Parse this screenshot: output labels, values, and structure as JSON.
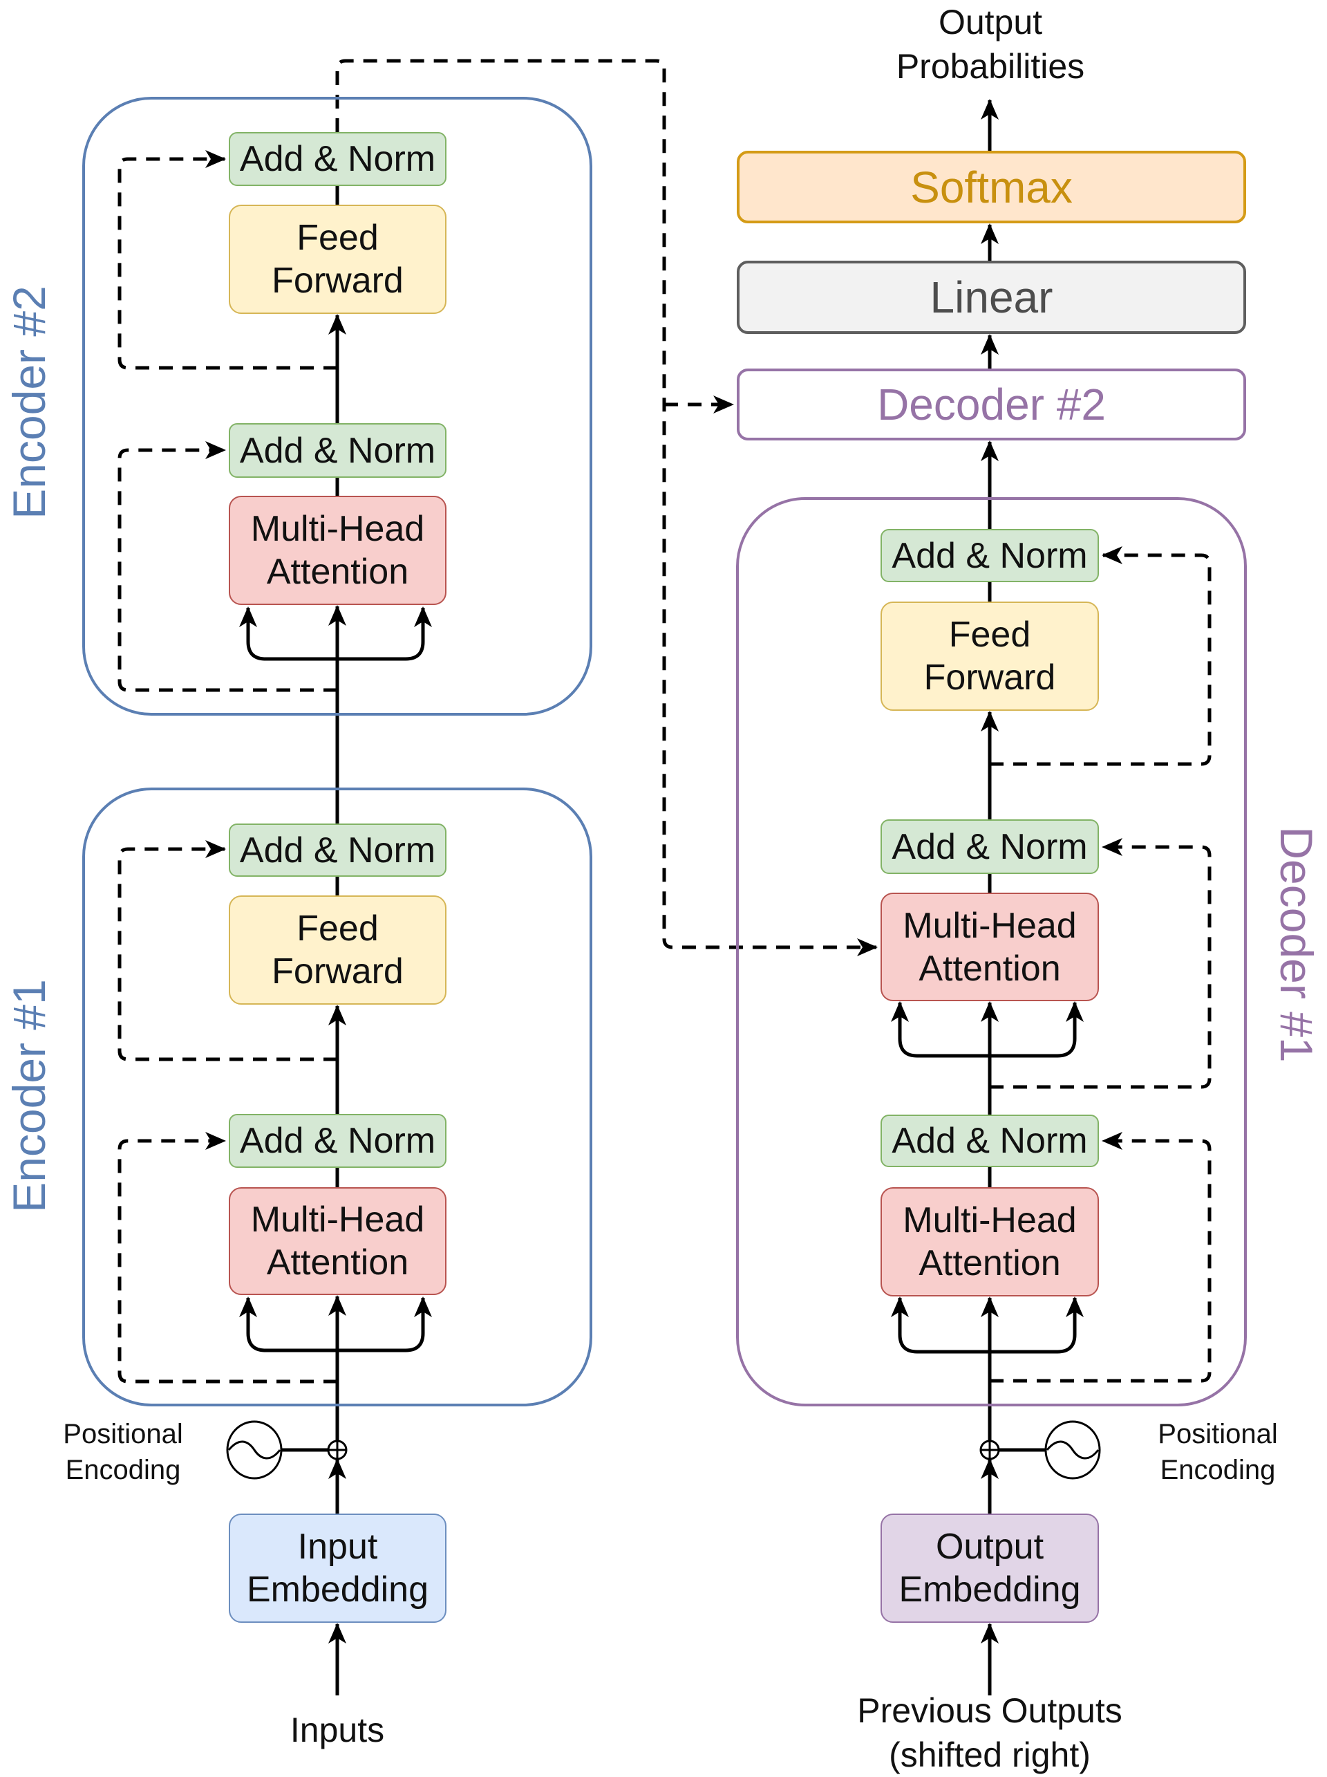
{
  "encoders": [
    {
      "label": "Encoder #2",
      "add_norm_top": "Add & Norm",
      "feed_forward": "Feed\nForward",
      "add_norm_bottom": "Add & Norm",
      "attention": "Multi-Head\nAttention"
    },
    {
      "label": "Encoder #1",
      "add_norm_top": "Add & Norm",
      "feed_forward": "Feed\nForward",
      "add_norm_bottom": "Add & Norm",
      "attention": "Multi-Head\nAttention"
    }
  ],
  "decoder1": {
    "label": "Decoder #1",
    "add_norm_top": "Add & Norm",
    "feed_forward": "Feed\nForward",
    "add_norm_middle": "Add & Norm",
    "cross_attention": "Multi-Head\nAttention",
    "add_norm_bottom": "Add & Norm",
    "self_attention": "Multi-Head\nAttention"
  },
  "decoder2": {
    "label": "Decoder #2"
  },
  "head": {
    "linear": "Linear",
    "softmax": "Softmax",
    "output_label": "Output\nProbabilities"
  },
  "inputs": {
    "embedding": "Input\nEmbedding",
    "label": "Inputs",
    "positional_encoding": "Positional\nEncoding"
  },
  "outputs": {
    "embedding": "Output\nEmbedding",
    "label": "Previous Outputs\n(shifted right)",
    "positional_encoding": "Positional\nEncoding"
  },
  "colors": {
    "encoder": "#5b7fb3",
    "decoder": "#9673a6",
    "add_norm": "#d5e8d4",
    "feed_forward": "#fff2cc",
    "attention": "#f8cecc",
    "input_embedding": "#dae8fc",
    "output_embedding": "#e1d5e7",
    "softmax": "#ffe6cc",
    "linear": "#f2f2f2"
  }
}
